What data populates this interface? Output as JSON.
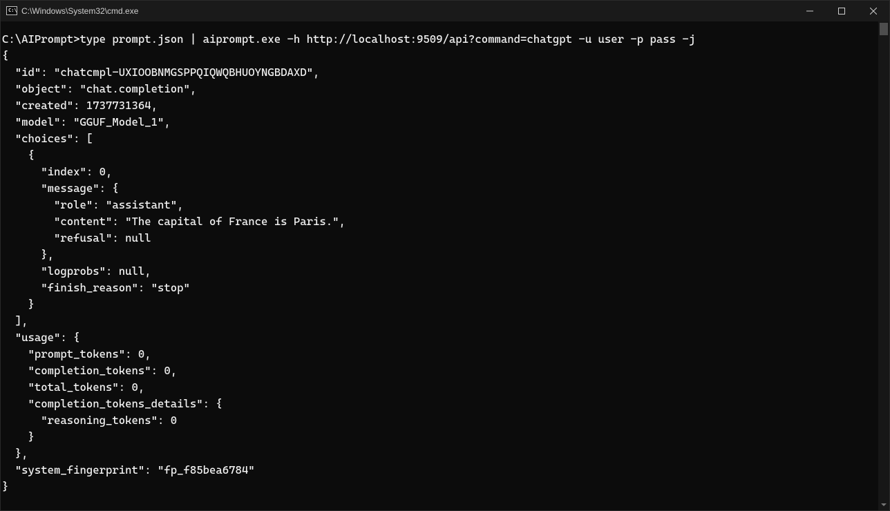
{
  "titlebar": {
    "title": "C:\\Windows\\System32\\cmd.exe"
  },
  "terminal": {
    "prompt": "C:\\AIPrompt>",
    "command": "type prompt.json | aiprompt.exe -h http://localhost:9509/api?command=chatgpt -u user -p pass -j",
    "output_lines": [
      "{",
      "  \"id\": \"chatcmpl-UXIOOBNMGSPPQIQWQBHUOYNGBDAXD\",",
      "  \"object\": \"chat.completion\",",
      "  \"created\": 1737731364,",
      "  \"model\": \"GGUF_Model_1\",",
      "  \"choices\": [",
      "    {",
      "      \"index\": 0,",
      "      \"message\": {",
      "        \"role\": \"assistant\",",
      "        \"content\": \"The capital of France is Paris.\",",
      "        \"refusal\": null",
      "      },",
      "      \"logprobs\": null,",
      "      \"finish_reason\": \"stop\"",
      "    }",
      "  ],",
      "  \"usage\": {",
      "    \"prompt_tokens\": 0,",
      "    \"completion_tokens\": 0,",
      "    \"total_tokens\": 0,",
      "    \"completion_tokens_details\": {",
      "      \"reasoning_tokens\": 0",
      "    }",
      "  },",
      "  \"system_fingerprint\": \"fp_f85bea6784\"",
      "}"
    ]
  }
}
